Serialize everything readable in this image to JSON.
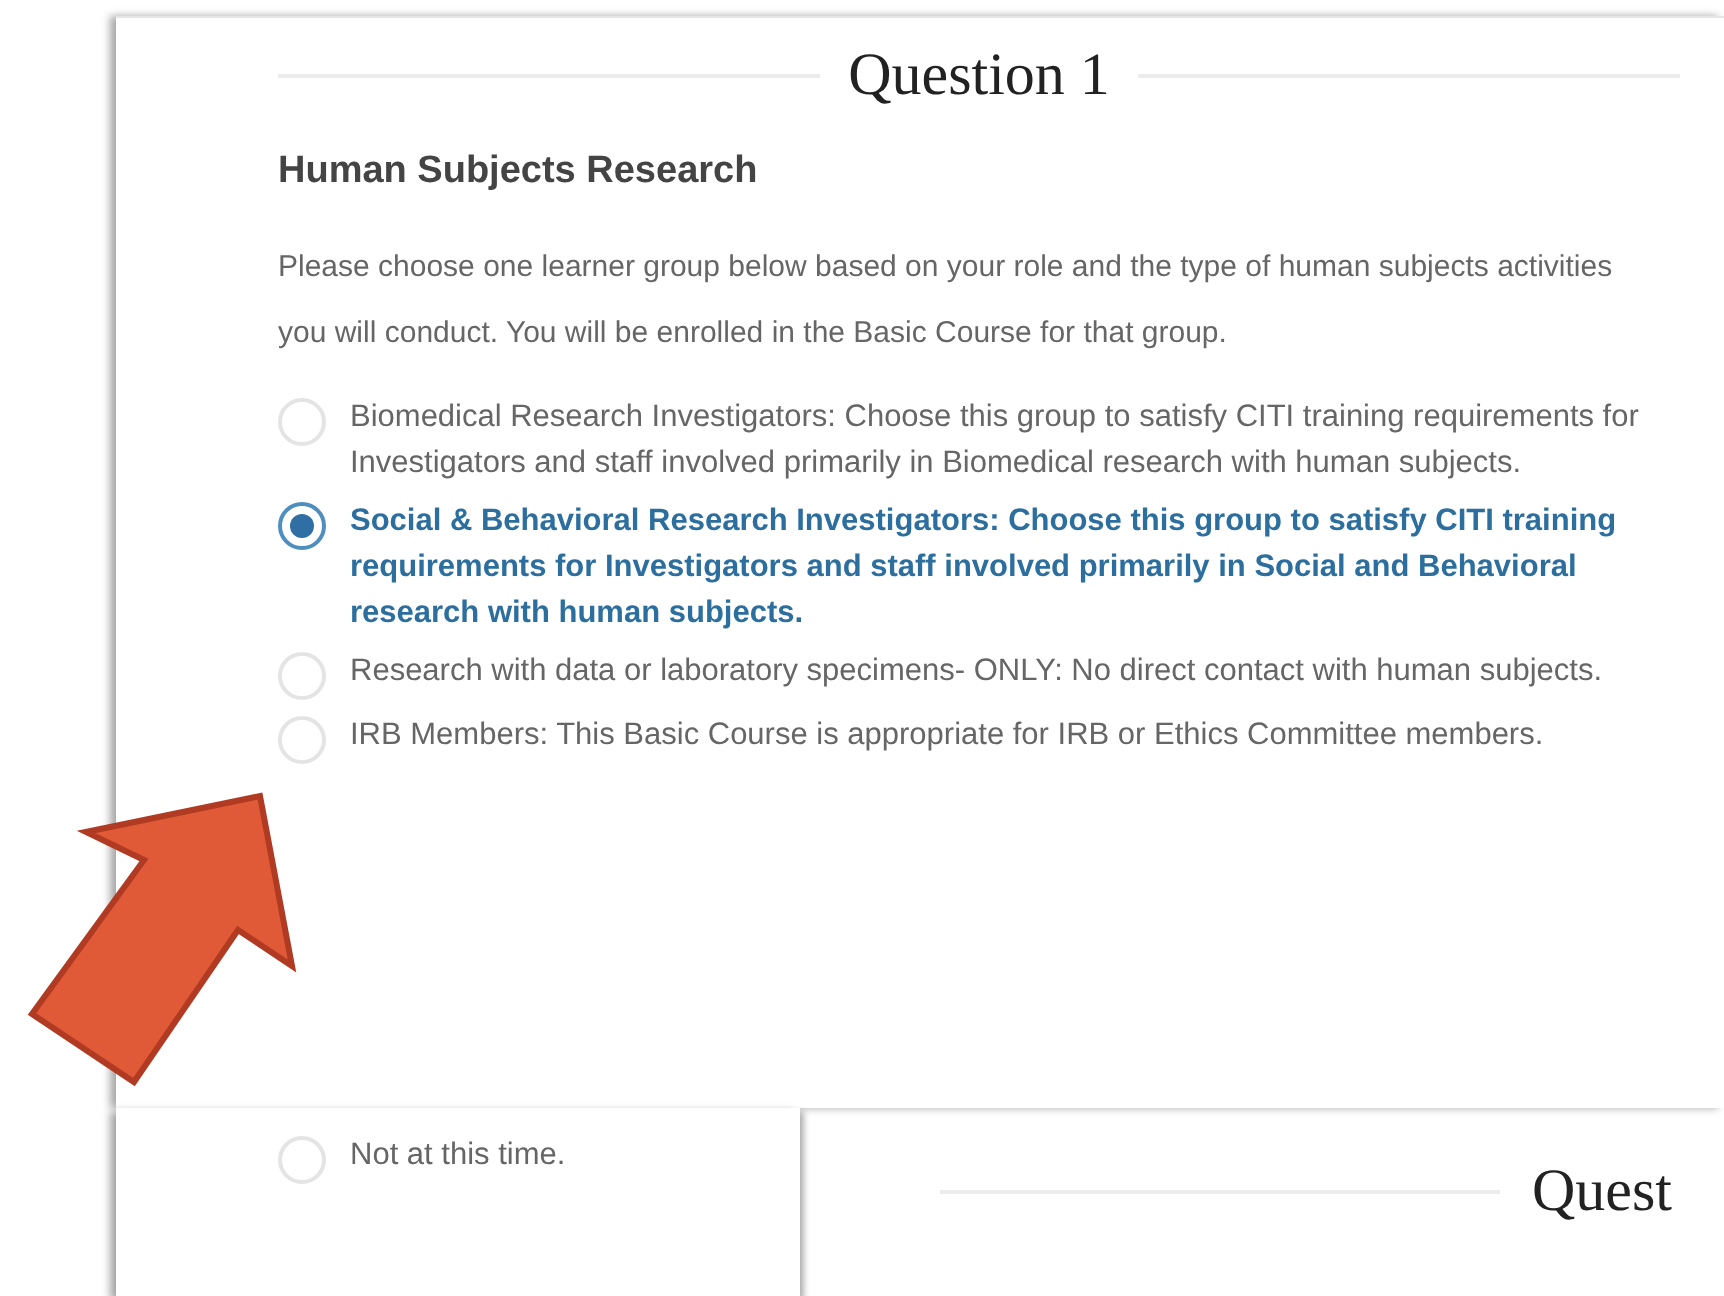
{
  "question_title": "Question 1",
  "section_heading": "Human Subjects Research",
  "instructions": "Please choose one learner group below based on your role and the type of human subjects activities you will conduct. You will be enrolled in the Basic Course for that group.",
  "options": [
    {
      "label": "Biomedical Research Investigators: Choose this group to satisfy CITI training requirements for Investigators and staff involved primarily in Biomedical research with human subjects.",
      "selected": false
    },
    {
      "label": "Social & Behavioral Research Investigators: Choose this group to satisfy CITI training requirements for Investigators and staff involved primarily in Social and Behavioral research with human subjects.",
      "selected": true
    },
    {
      "label": "Research with data or laboratory specimens- ONLY: No direct contact with human subjects.",
      "selected": false
    },
    {
      "label": "IRB Members: This Basic Course is appropriate for IRB or Ethics Committee members.",
      "selected": false
    },
    {
      "label": "Not at this time.",
      "selected": false
    }
  ],
  "next_question_title": "Quest"
}
